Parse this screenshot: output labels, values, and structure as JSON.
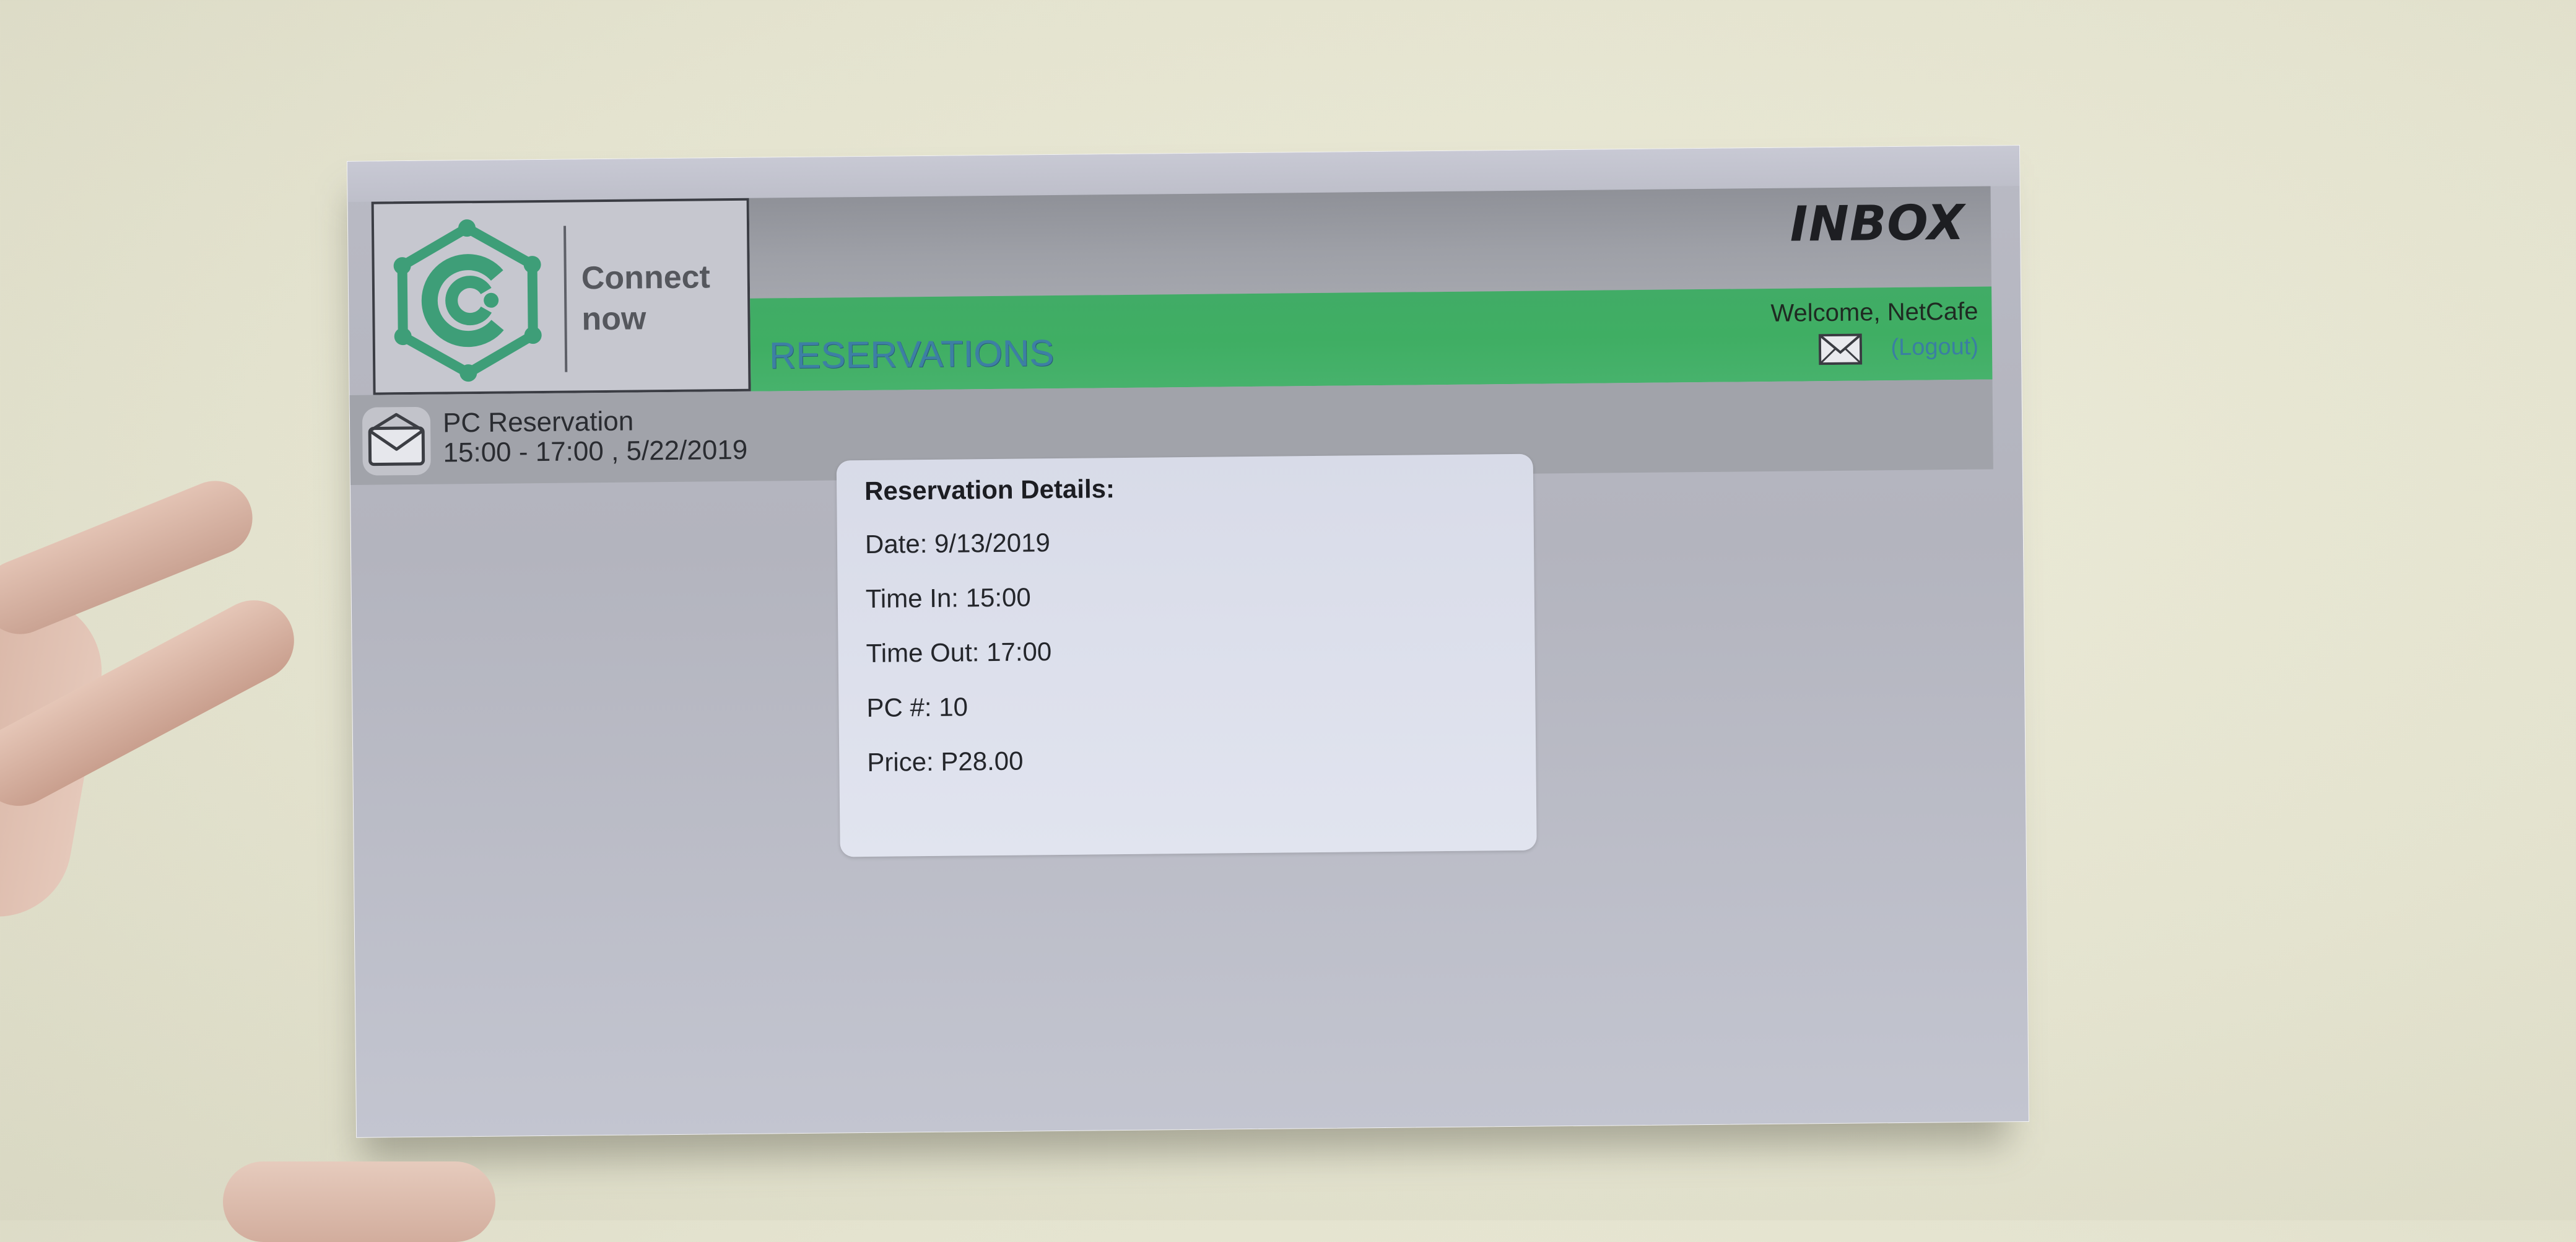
{
  "brand": {
    "name": "Connect now"
  },
  "header": {
    "title": "INBOX"
  },
  "nav": {
    "section_title": "RESERVATIONS",
    "welcome_text": "Welcome, NetCafe",
    "logout_label": "(Logout)"
  },
  "inbox_item": {
    "title": "PC Reservation",
    "subtitle": "15:00 - 17:00 , 5/22/2019"
  },
  "details": {
    "heading": "Reservation Details:",
    "date": "Date: 9/13/2019",
    "time_in": "Time In: 15:00",
    "time_out": "Time Out: 17:00",
    "pc": "PC #: 10",
    "price": "Price: P28.00"
  },
  "colors": {
    "brand_green": "#3fae63",
    "link_blue": "#3a7ea3",
    "header_gray": "#9ea0a7"
  },
  "icons": [
    "logo-icon",
    "mail-icon",
    "envelope-icon"
  ]
}
